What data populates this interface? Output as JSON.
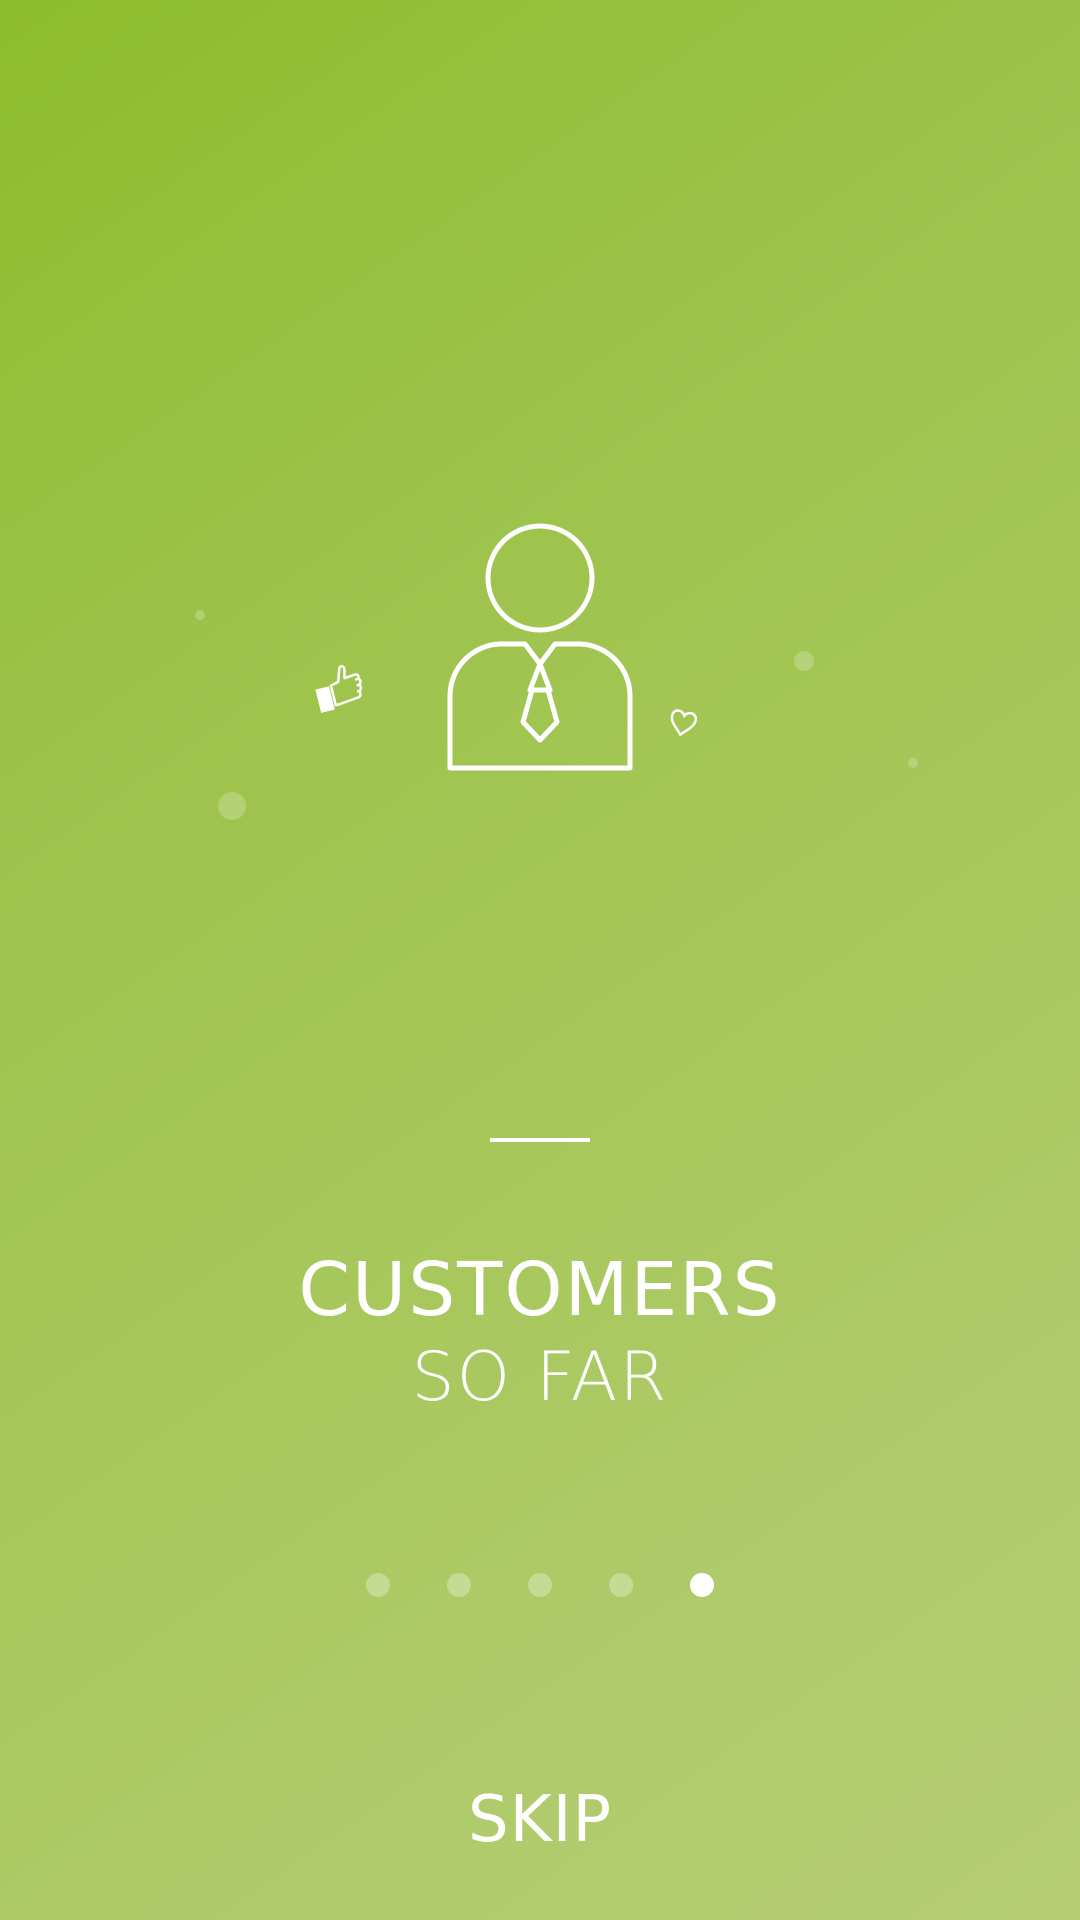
{
  "screen": {
    "background_colors": [
      "#8cbd2c",
      "#b6cd72"
    ]
  },
  "illustration": {
    "icons": [
      "customer-icon",
      "thumbs-up-icon",
      "heart-icon"
    ]
  },
  "content": {
    "title": "CUSTOMERS",
    "subtitle": "SO FAR"
  },
  "pagination": {
    "total": 5,
    "active_index": 4
  },
  "actions": {
    "skip_label": "SKIP"
  }
}
